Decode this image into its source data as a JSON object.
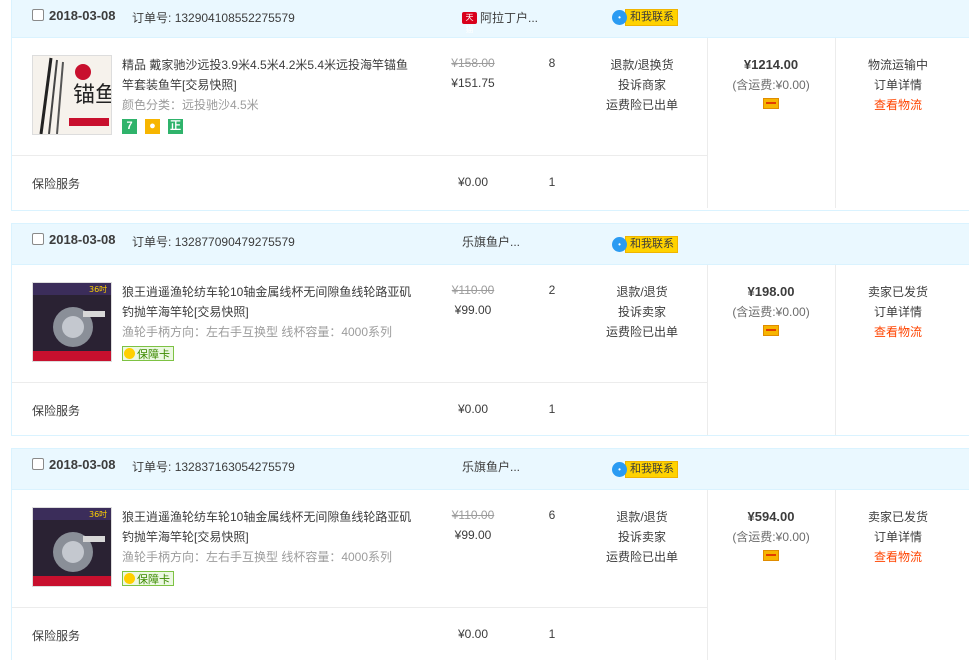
{
  "labels": {
    "order_no": "订单号:",
    "contact": "和我联系",
    "tmall": "天猫",
    "service": "保险服务",
    "snapshot": "[交易快照]",
    "shipping_prefix": "(含运费:",
    "shipping_suffix": ")",
    "order_detail": "订单详情",
    "view_logistics": "查看物流",
    "freight_insurance": "运费险已出单",
    "guarantee_card": "保障卡"
  },
  "orders": [
    {
      "date": "2018-03-08",
      "order_number": "132904108552275579",
      "shop": "阿拉丁户...",
      "title": "精品 戴家驰沙远投3.9米4.5米4.2米5.4米远投海竿锚鱼竿套装鱼竿",
      "sku": "颜色分类：远投驰沙4.5米",
      "price_original": "¥158.00",
      "price_current": "¥151.75",
      "quantity": "8",
      "op1": "退款/退换货",
      "op2": "投诉商家",
      "total": "¥1214.00",
      "shipping": "¥0.00",
      "status": "物流运输中",
      "service_price": "¥0.00",
      "service_qty": "1"
    },
    {
      "date": "2018-03-08",
      "order_number": "132877090479275579",
      "shop": "乐旗鱼户...",
      "title": "狼王逍遥渔轮纺车轮10轴金属线杯无间隙鱼线轮路亚矶钓抛竿海竿轮",
      "sku": "渔轮手柄方向：左右手互换型  线杯容量：4000系列",
      "price_original": "¥110.00",
      "price_current": "¥99.00",
      "quantity": "2",
      "op1": "退款/退货",
      "op2": "投诉卖家",
      "total": "¥198.00",
      "shipping": "¥0.00",
      "status": "卖家已发货",
      "service_price": "¥0.00",
      "service_qty": "1"
    },
    {
      "date": "2018-03-08",
      "order_number": "132837163054275579",
      "shop": "乐旗鱼户...",
      "title": "狼王逍遥渔轮纺车轮10轴金属线杯无间隙鱼线轮路亚矶钓抛竿海竿轮",
      "sku": "渔轮手柄方向：左右手互换型  线杯容量：4000系列",
      "price_original": "¥110.00",
      "price_current": "¥99.00",
      "quantity": "6",
      "op1": "退款/退货",
      "op2": "投诉卖家",
      "total": "¥594.00",
      "shipping": "¥0.00",
      "status": "卖家已发货",
      "service_price": "¥0.00",
      "service_qty": "1"
    }
  ],
  "badges": {
    "seven_day": "7",
    "genuine": "正"
  },
  "thumbs": {
    "rod_text": "锚鱼竿",
    "reel_tag": "36吋"
  }
}
